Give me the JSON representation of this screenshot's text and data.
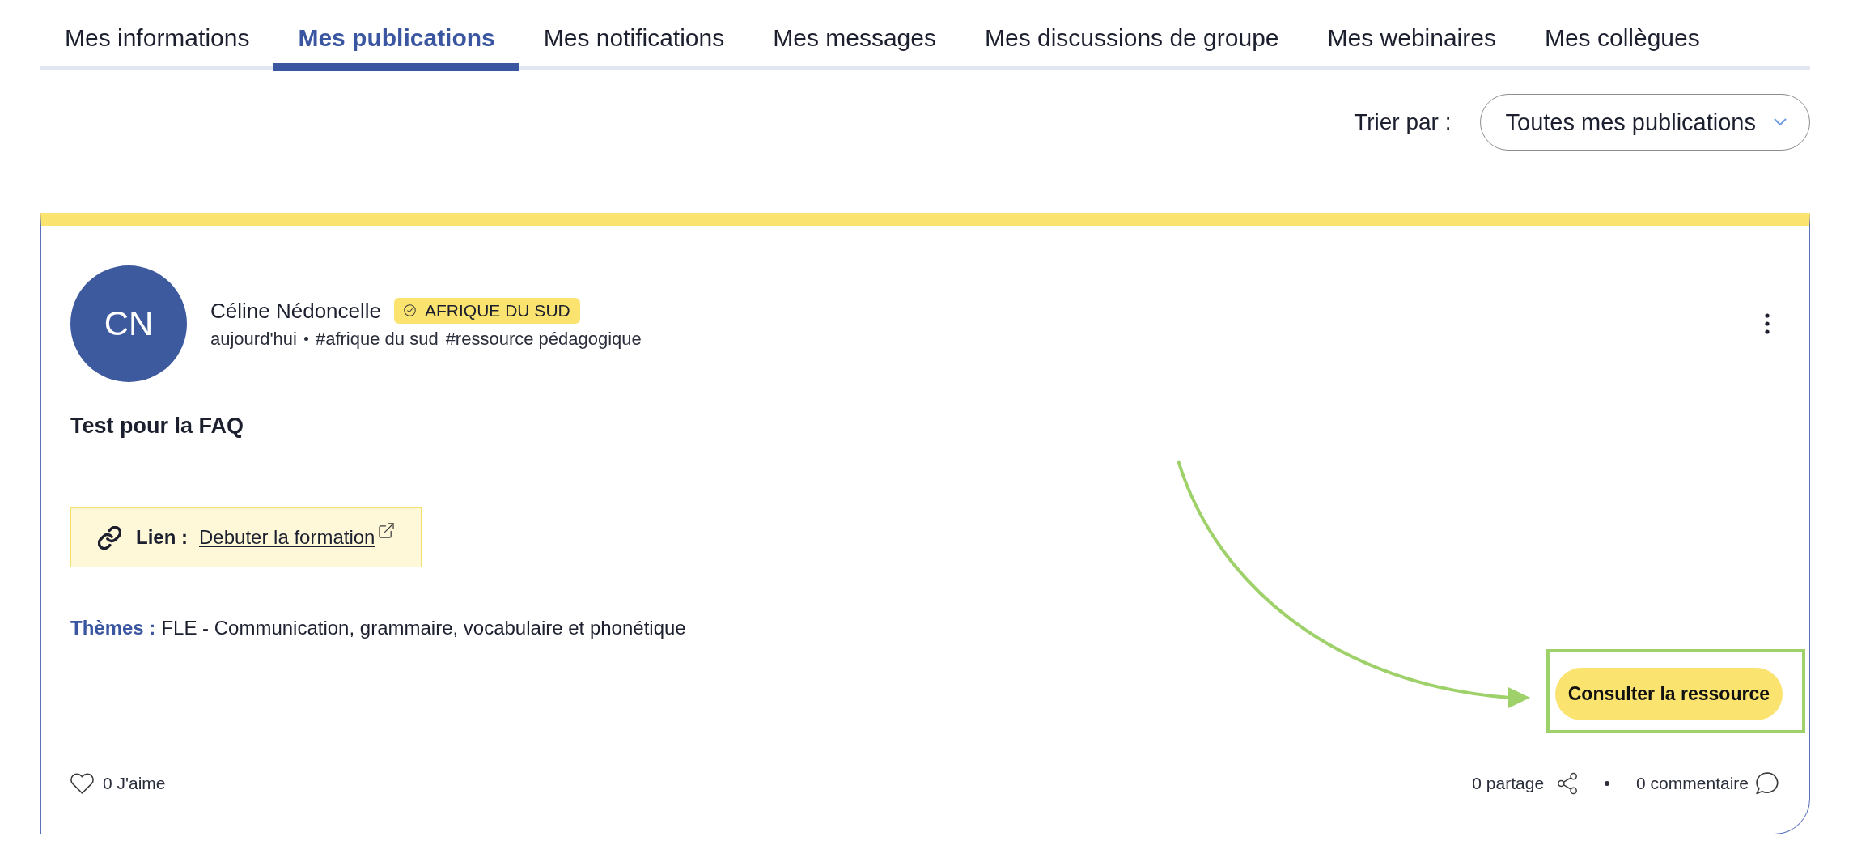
{
  "tabs": [
    {
      "label": "Mes informations",
      "selected": false
    },
    {
      "label": "Mes publications",
      "selected": true
    },
    {
      "label": "Mes notifications",
      "selected": false
    },
    {
      "label": "Mes messages",
      "selected": false
    },
    {
      "label": "Mes discussions de groupe",
      "selected": false
    },
    {
      "label": "Mes webinaires",
      "selected": false
    },
    {
      "label": "Mes collègues",
      "selected": false
    }
  ],
  "sort": {
    "label": "Trier par :",
    "value": "Toutes mes publications"
  },
  "post": {
    "author": {
      "initials": "CN",
      "name": "Céline Nédoncelle"
    },
    "badge": {
      "label": "AFRIQUE DU SUD"
    },
    "date": "aujourd'hui",
    "tags": [
      "#afrique du sud",
      "#ressource pédagogique"
    ],
    "title": "Test pour la FAQ",
    "link": {
      "label": "Lien :",
      "text": "Debuter la formation"
    },
    "themes": {
      "label": "Thèmes :",
      "value": "FLE - Communication, grammaire, vocabulaire et phonétique"
    },
    "action": {
      "label": "Consulter la ressource",
      "highlighted": true
    },
    "likes": "0 J'aime",
    "shares": "0 partage",
    "comments": "0 commentaire"
  }
}
